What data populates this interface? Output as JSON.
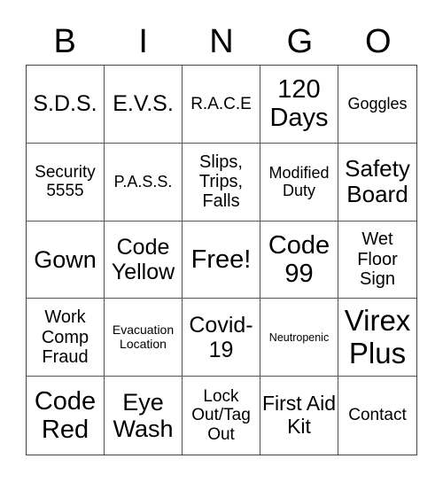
{
  "header": [
    "B",
    "I",
    "N",
    "G",
    "O"
  ],
  "cells": [
    "S.D.S.",
    "E.V.S.",
    "R.A.C.E",
    "120 Days",
    "Goggles",
    "Security 5555",
    "P.A.S.S.",
    "Slips, Trips, Falls",
    "Modified Duty",
    "Safety Board",
    "Gown",
    "Code Yellow",
    "Free!",
    "Code 99",
    "Wet Floor Sign",
    "Work Comp Fraud",
    "Evacuation Location",
    "Covid-19",
    "Neutropenic",
    "Virex Plus",
    "Code Red",
    "Eye Wash",
    "Lock Out/Tag Out",
    "First Aid Kit",
    "Contact"
  ]
}
